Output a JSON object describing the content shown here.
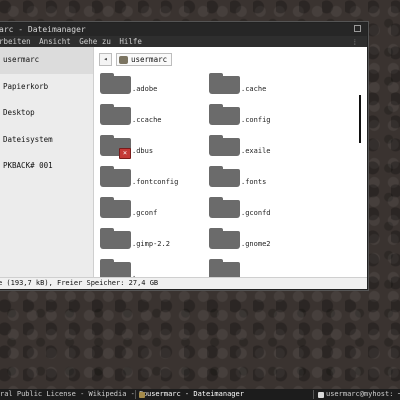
{
  "window": {
    "title": "arc - Dateimanager",
    "menu": [
      "rbeiten",
      "Ansicht",
      "Gehe zu",
      "Hilfe"
    ]
  },
  "sidebar": {
    "items": [
      {
        "label": "usermarc"
      },
      {
        "label": "Papierkorb"
      },
      {
        "label": "Desktop"
      },
      {
        "label": "Dateisystem"
      },
      {
        "label": "PKBACK# 001"
      }
    ]
  },
  "pathbar": {
    "back_glyph": "◂",
    "crumb": "usermarc",
    "crumb_icon": "home-folder-icon"
  },
  "files": [
    {
      "name": ".adobe"
    },
    {
      "name": ".cache"
    },
    {
      "name": ".ccache"
    },
    {
      "name": ".config"
    },
    {
      "name": ".dbus",
      "badge": "×"
    },
    {
      "name": ".exaile"
    },
    {
      "name": ".fontconfig"
    },
    {
      "name": ".fonts"
    },
    {
      "name": ".gconf"
    },
    {
      "name": ".gconfd"
    },
    {
      "name": ".gimp-2.2"
    },
    {
      "name": ".gnome2"
    },
    {
      "name": "."
    },
    {
      "name": ""
    }
  ],
  "status": {
    "text": "e (193,7 kB), Freier Speicher: 27,4 GB"
  },
  "taskbar": {
    "tasks": [
      {
        "label": "ral Public License - Wikipedia - Bo"
      },
      {
        "label": "usermarc - Dateimanager"
      },
      {
        "label": "usermarc@myhost: ~/"
      }
    ]
  },
  "colors": {
    "folder": "#6b6b6b",
    "badge": "#c43a37",
    "titlebar": "#262626",
    "desktop": "#3a3330"
  }
}
